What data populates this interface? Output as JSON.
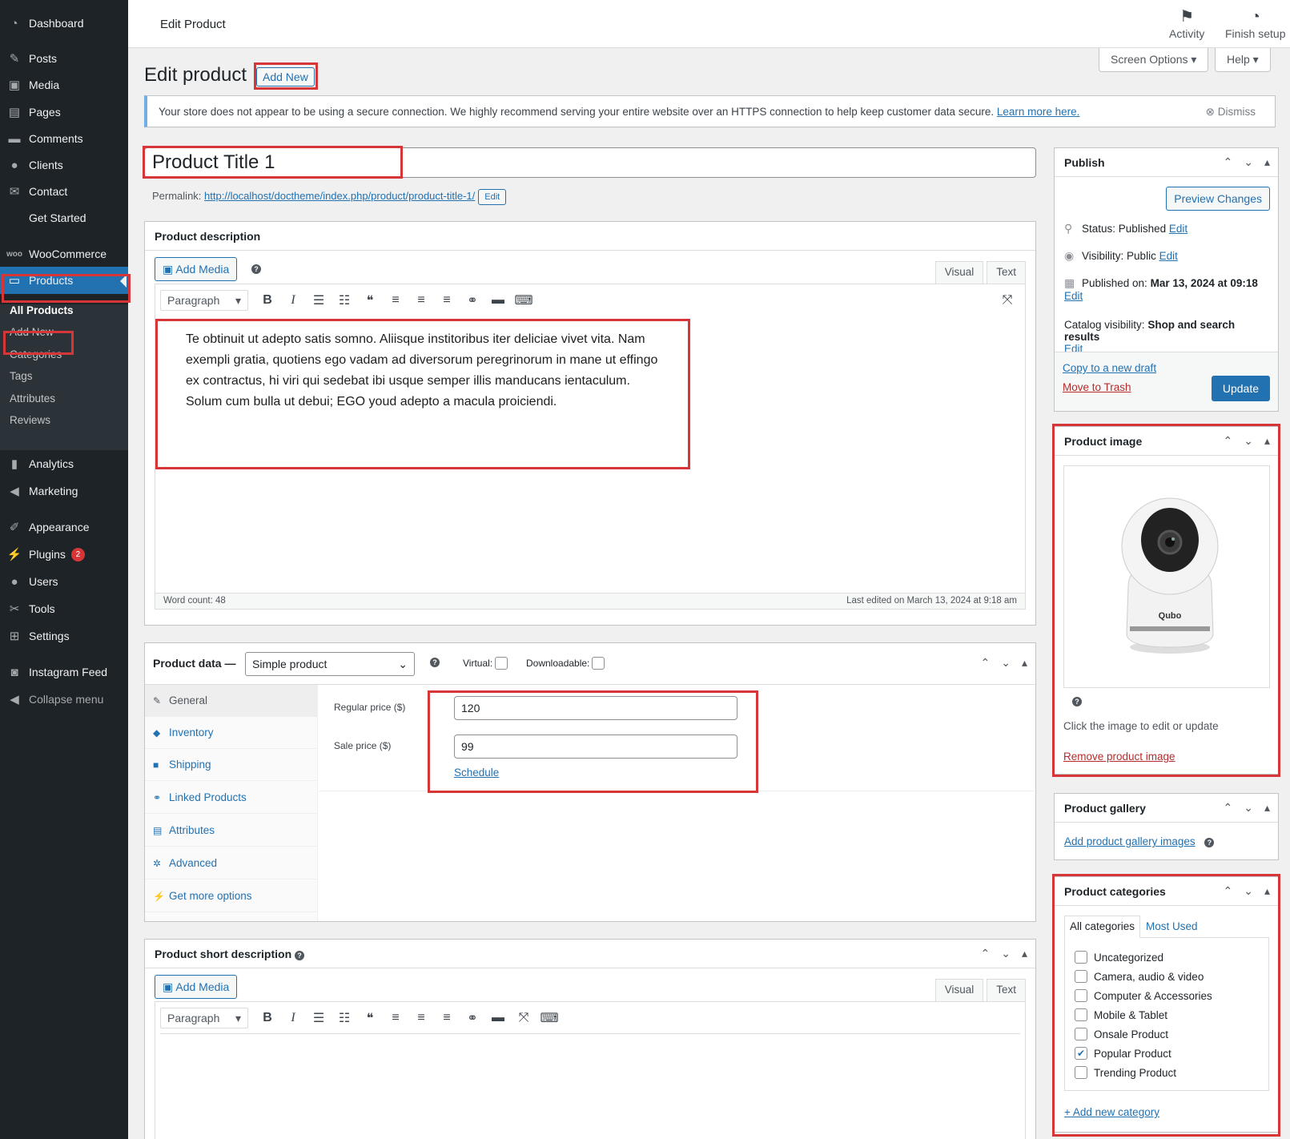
{
  "sidebar": {
    "items": [
      {
        "label": "Dashboard",
        "icon": "dashboard-icon"
      },
      {
        "label": "Posts",
        "icon": "pin-icon"
      },
      {
        "label": "Media",
        "icon": "media-icon"
      },
      {
        "label": "Pages",
        "icon": "pages-icon"
      },
      {
        "label": "Comments",
        "icon": "comment-icon"
      },
      {
        "label": "Clients",
        "icon": "users-icon"
      },
      {
        "label": "Contact",
        "icon": "mail-icon"
      },
      {
        "label": "Get Started",
        "icon": ""
      },
      {
        "label": "WooCommerce",
        "icon": "woo-icon"
      },
      {
        "label": "Products",
        "icon": "archive-icon"
      },
      {
        "label": "Analytics",
        "icon": "chart-bar-icon"
      },
      {
        "label": "Marketing",
        "icon": "megaphone-icon"
      },
      {
        "label": "Appearance",
        "icon": "paintbrush-icon"
      },
      {
        "label": "Plugins",
        "icon": "plugin-icon",
        "badge": "2"
      },
      {
        "label": "Users",
        "icon": "user-icon"
      },
      {
        "label": "Tools",
        "icon": "wrench-icon"
      },
      {
        "label": "Settings",
        "icon": "settings-icon"
      },
      {
        "label": "Instagram Feed",
        "icon": "camera-icon"
      },
      {
        "label": "Collapse menu",
        "icon": "collapse-icon"
      }
    ],
    "submenu": [
      "All Products",
      "Add New",
      "Categories",
      "Tags",
      "Attributes",
      "Reviews"
    ]
  },
  "topbar": {
    "screen_title": "Edit Product",
    "activity": "Activity",
    "finish_setup": "Finish setup",
    "screen_options": "Screen Options ▾",
    "help": "Help ▾"
  },
  "page": {
    "title": "Edit product",
    "add_new": "Add New",
    "notice": "Your store does not appear to be using a secure connection. We highly recommend serving your entire website over an HTTPS connection to help keep customer data secure.",
    "notice_link": "Learn more here.",
    "dismiss": "Dismiss",
    "product_title": "Product Title 1",
    "permalink_label": "Permalink:",
    "permalink_url": "http://localhost/doctheme/index.php/product/product-title-1/",
    "permalink_edit": "Edit"
  },
  "description": {
    "heading": "Product description",
    "add_media": "Add Media",
    "tab_visual": "Visual",
    "tab_text": "Text",
    "format": "Paragraph",
    "body": "Te obtinuit ut adepto satis somno. Aliisque institoribus iter deliciae vivet vita. Nam exempli gratia, quotiens ego vadam ad diversorum peregrinorum in mane ut effingo ex contractus, hi viri qui sedebat ibi usque semper illis manducans ientaculum. Solum cum bulla ut debui; EGO youd adepto a macula proiciendi.",
    "word_count": "Word count: 48",
    "last_edited": "Last edited on March 13, 2024 at 9:18 am"
  },
  "product_data": {
    "heading": "Product data —",
    "type": "Simple product",
    "virtual": "Virtual:",
    "downloadable": "Downloadable:",
    "tabs": [
      "General",
      "Inventory",
      "Shipping",
      "Linked Products",
      "Attributes",
      "Advanced",
      "Get more options"
    ],
    "regular_price_label": "Regular price ($)",
    "regular_price": "120",
    "sale_price_label": "Sale price ($)",
    "sale_price": "99",
    "schedule": "Schedule"
  },
  "short_description": {
    "heading": "Product short description",
    "add_media": "Add Media",
    "tab_visual": "Visual",
    "tab_text": "Text",
    "format": "Paragraph"
  },
  "publish": {
    "heading": "Publish",
    "preview": "Preview Changes",
    "status_label": "Status:",
    "status_value": "Published",
    "visibility_label": "Visibility:",
    "visibility_value": "Public",
    "published_label": "Published on:",
    "published_value": "Mar 13, 2024 at 09:18",
    "catalog_label": "Catalog visibility:",
    "catalog_value": "Shop and search results",
    "edit": "Edit",
    "copy_draft": "Copy to a new draft",
    "trash": "Move to Trash",
    "update": "Update"
  },
  "product_image": {
    "heading": "Product image",
    "brand_text": "Qubo",
    "hint": "Click the image to edit or update",
    "remove": "Remove product image"
  },
  "gallery": {
    "heading": "Product gallery",
    "add": "Add product gallery images"
  },
  "categories": {
    "heading": "Product categories",
    "tab_all": "All categories",
    "tab_used": "Most Used",
    "items": [
      {
        "label": "Uncategorized",
        "checked": false
      },
      {
        "label": "Camera, audio & video",
        "checked": false
      },
      {
        "label": "Computer & Accessories",
        "checked": false
      },
      {
        "label": "Mobile & Tablet",
        "checked": false
      },
      {
        "label": "Onsale Product",
        "checked": false
      },
      {
        "label": "Popular Product",
        "checked": true
      },
      {
        "label": "Trending Product",
        "checked": false
      }
    ],
    "add_new": "+ Add new category"
  },
  "colors": {
    "accent": "#2271b1",
    "highlight": "#d63638",
    "sidebar": "#1d2327"
  }
}
